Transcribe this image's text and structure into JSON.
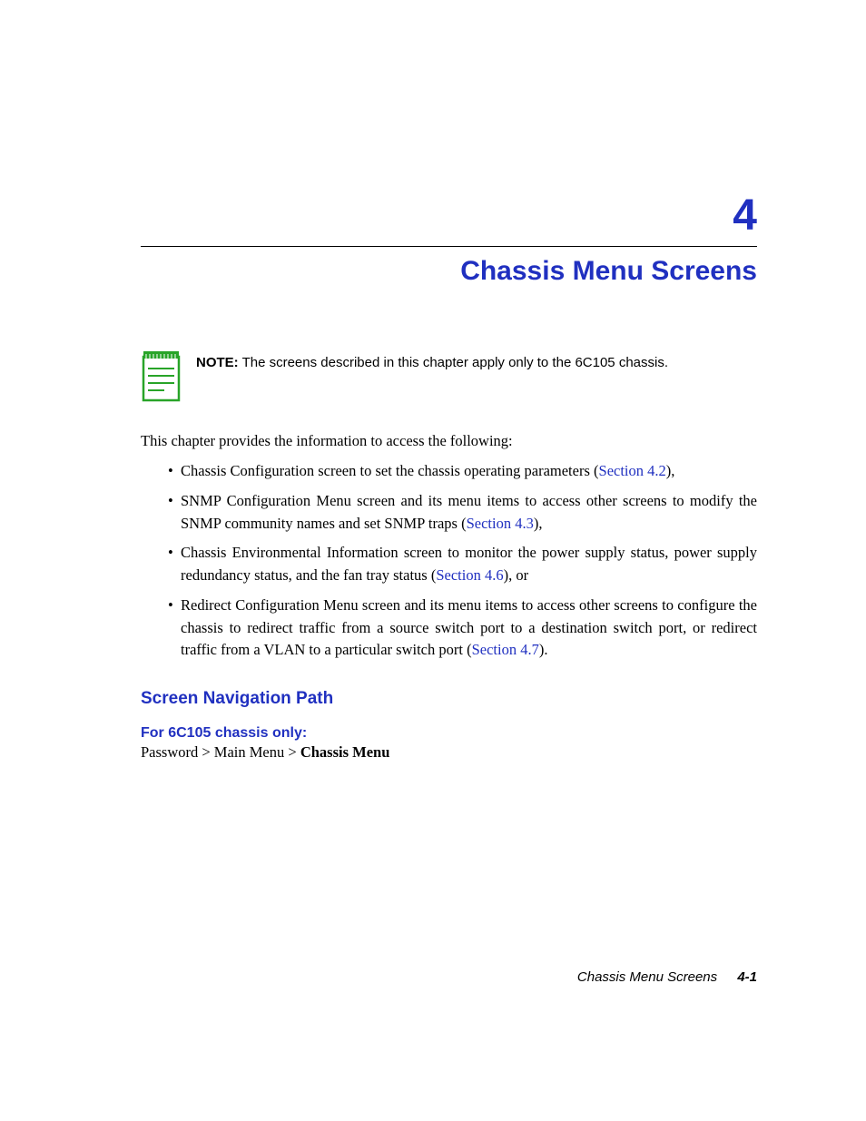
{
  "chapter": {
    "number": "4",
    "title": "Chassis Menu Screens"
  },
  "note": {
    "label": "NOTE:",
    "body": "The screens described in this chapter apply only to the 6C105 chassis."
  },
  "intro": "This chapter provides the information to access the following:",
  "bullets": [
    {
      "pre": "Chassis Configuration screen to set the chassis operating parameters (",
      "link": "Section 4.2",
      "post": "),"
    },
    {
      "pre": "SNMP Configuration Menu screen and its menu items to access other screens to modify the SNMP community names and set SNMP traps (",
      "link": "Section 4.3",
      "post": "),"
    },
    {
      "pre": "Chassis Environmental Information screen to monitor the power supply status, power supply redundancy status, and the fan tray status (",
      "link": "Section 4.6",
      "post": "), or"
    },
    {
      "pre": "Redirect Configuration Menu screen and its menu items to access other screens to configure the chassis to redirect traffic from a source switch port to a destination switch port, or redirect traffic from a VLAN to a particular switch port (",
      "link": "Section 4.7",
      "post": ")."
    }
  ],
  "nav": {
    "heading": "Screen Navigation Path",
    "sub": "For 6C105 chassis only:",
    "path_plain": "Password > Main Menu > ",
    "path_bold": "Chassis Menu"
  },
  "footer": {
    "title": "Chassis Menu Screens",
    "page": "4-1"
  }
}
